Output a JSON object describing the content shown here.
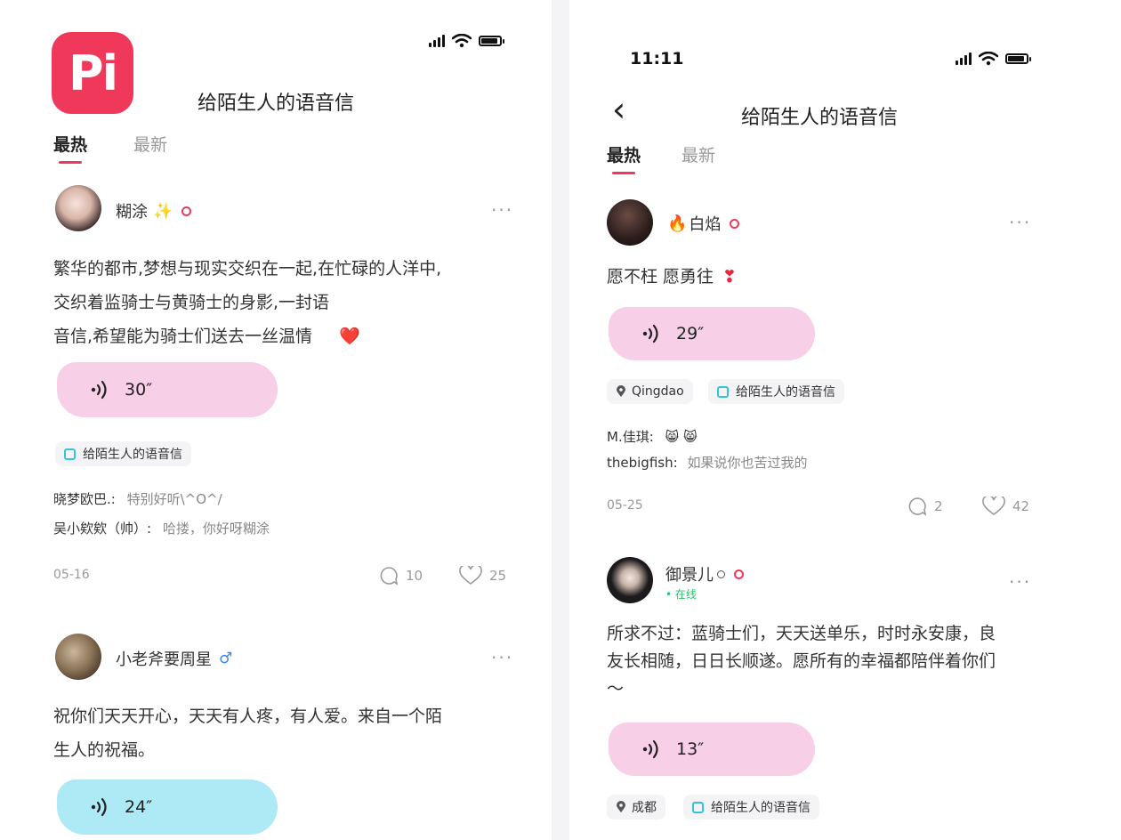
{
  "left": {
    "title": "给陌生人的语音信",
    "logo_text": "Pi",
    "tabs": [
      {
        "label": "最热",
        "active": true
      },
      {
        "label": "最新",
        "active": false
      }
    ],
    "posts": [
      {
        "username": "糊涂",
        "user_emoji": "✨",
        "text_lines": [
          "繁华的都市,梦想与现实交织在一起,在忙碌的人洋中,",
          "交织着监骑士与黄骑士的身影,一封语",
          "音信,希望能为骑士们送去一丝温情"
        ],
        "text_emoji": "❤️",
        "voice": "30″",
        "voice_color": "#f7cfe6",
        "topic": "给陌生人的语音信",
        "comments": [
          {
            "user": "晓梦欧巴.:",
            "text": "特别好听\\^O^/"
          },
          {
            "user": "吴小欸欸（帅）:",
            "text": "哈搂，你好呀糊涂"
          }
        ],
        "date": "05-16",
        "comment_count": "10",
        "like_count": "25"
      },
      {
        "username": "小老斧要周星",
        "gender_icon": "♂",
        "text_lines": [
          "祝你们天天开心，天天有人疼，有人爱。来自一个陌",
          "生人的祝福。"
        ],
        "voice": "24″",
        "voice_color": "#aee9f6"
      }
    ],
    "more": "···"
  },
  "right": {
    "time": "11:11",
    "back_icon": "‹",
    "title": "给陌生人的语音信",
    "tabs": [
      {
        "label": "最热",
        "active": true
      },
      {
        "label": "最新",
        "active": false
      }
    ],
    "posts": [
      {
        "username": "白焰",
        "user_emoji": "🔥",
        "text": "愿不枉 愿勇往",
        "text_emoji": "❣",
        "voice": "29″",
        "voice_color": "#f7cfe6",
        "location": "Qingdao",
        "topic": "给陌生人的语音信",
        "comments": [
          {
            "user": "M.佳琪:",
            "text": "😸 😸"
          },
          {
            "user": "thebigfish:",
            "text": "如果说你也苦过我的"
          }
        ],
        "date": "05-25",
        "comment_count": "2",
        "like_count": "42"
      },
      {
        "username": "御景儿",
        "online": "• 在线",
        "text_lines": [
          "所求不过：蓝骑士们，天天送单乐，时时永安康，良",
          "友长相随，日日长顺遂。愿所有的幸福都陪伴着你们",
          "～"
        ],
        "voice": "13″",
        "voice_color": "#f7cfe6",
        "location": "成都",
        "topic": "给陌生人的语音信"
      }
    ],
    "more": "···"
  }
}
